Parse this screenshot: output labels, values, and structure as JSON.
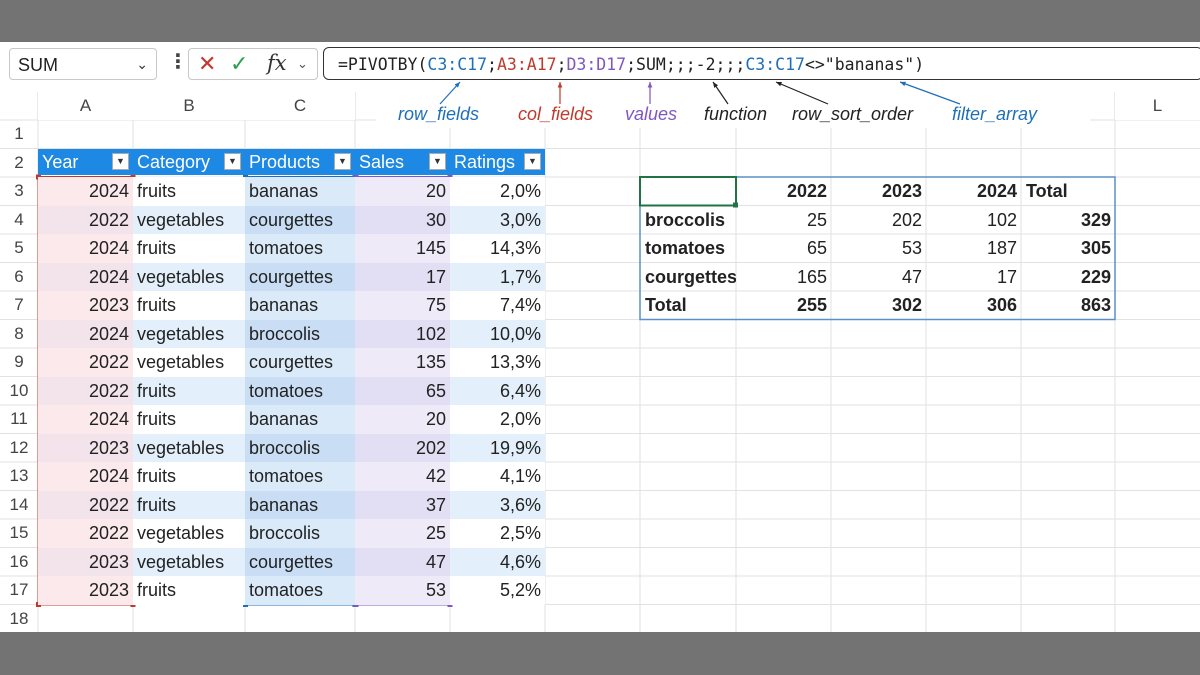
{
  "namebox": {
    "value": "SUM"
  },
  "formula_bar": {
    "cancel": "✕",
    "enter": "✓",
    "fx": "fx",
    "formula": {
      "p1": "=PIVOTBY(",
      "row": "C3:C17",
      "s1": ";",
      "col": "A3:A17",
      "s2": ";",
      "val": "D3:D17",
      "s3": ";SUM;;;-2;;;",
      "filt": "C3:C17",
      "p2": "<>\"bananas\")"
    }
  },
  "columns": [
    "A",
    "B",
    "C",
    "L"
  ],
  "annotations": {
    "row_fields": "row_fields",
    "col_fields": "col_fields",
    "values": "values",
    "function": "function",
    "row_sort_order": "row_sort_order",
    "filter_array": "filter_array"
  },
  "table": {
    "headers": [
      "Year",
      "Category",
      "Products",
      "Sales",
      "Ratings"
    ],
    "rows": [
      [
        "2024",
        "fruits",
        "bananas",
        "20",
        "2,0%"
      ],
      [
        "2022",
        "vegetables",
        "courgettes",
        "30",
        "3,0%"
      ],
      [
        "2024",
        "fruits",
        "tomatoes",
        "145",
        "14,3%"
      ],
      [
        "2024",
        "vegetables",
        "courgettes",
        "17",
        "1,7%"
      ],
      [
        "2023",
        "fruits",
        "bananas",
        "75",
        "7,4%"
      ],
      [
        "2024",
        "vegetables",
        "broccolis",
        "102",
        "10,0%"
      ],
      [
        "2022",
        "vegetables",
        "courgettes",
        "135",
        "13,3%"
      ],
      [
        "2022",
        "fruits",
        "tomatoes",
        "65",
        "6,4%"
      ],
      [
        "2024",
        "fruits",
        "bananas",
        "20",
        "2,0%"
      ],
      [
        "2023",
        "vegetables",
        "broccolis",
        "202",
        "19,9%"
      ],
      [
        "2024",
        "fruits",
        "tomatoes",
        "42",
        "4,1%"
      ],
      [
        "2022",
        "fruits",
        "bananas",
        "37",
        "3,6%"
      ],
      [
        "2022",
        "vegetables",
        "broccolis",
        "25",
        "2,5%"
      ],
      [
        "2023",
        "vegetables",
        "courgettes",
        "47",
        "4,6%"
      ],
      [
        "2023",
        "fruits",
        "tomatoes",
        "53",
        "5,2%"
      ]
    ]
  },
  "pivot": {
    "col_headers": [
      "2022",
      "2023",
      "2024",
      "Total"
    ],
    "rows": [
      {
        "label": "broccolis",
        "values": [
          "25",
          "202",
          "102",
          "329"
        ]
      },
      {
        "label": "tomatoes",
        "values": [
          "65",
          "53",
          "187",
          "305"
        ]
      },
      {
        "label": "courgettes",
        "values": [
          "165",
          "47",
          "17",
          "229"
        ]
      },
      {
        "label": "Total",
        "values": [
          "255",
          "302",
          "306",
          "863"
        ]
      }
    ]
  },
  "colors": {
    "header_blue": "#1e88e5",
    "row_ref_red": "#c0392b",
    "prod_ref_blue": "#1f6fb8",
    "sales_ref_purple": "#7e57c2"
  }
}
